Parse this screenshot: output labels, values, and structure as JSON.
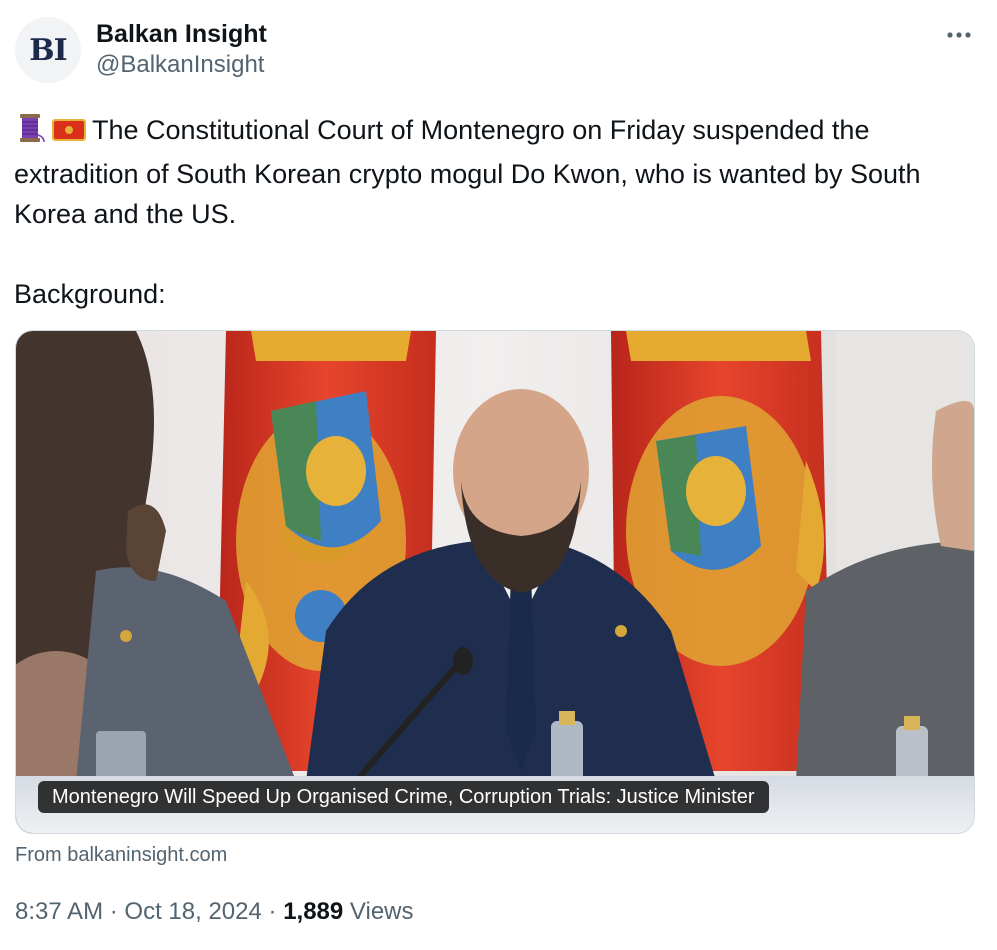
{
  "author": {
    "avatar_text": "BI",
    "display_name": "Balkan Insight",
    "handle": "@BalkanInsight"
  },
  "more_icon": "more-horizontal-icon",
  "tweet": {
    "emoji_1": "thread-spool-emoji",
    "emoji_2": "montenegro-flag-emoji",
    "text_line_1": "The Constitutional Court of Montenegro on Friday suspended the extradition of South Korean crypto mogul Do Kwon, who is wanted by South Korea and the US.",
    "text_line_2": "Background:"
  },
  "card": {
    "title": "Montenegro Will Speed Up Organised Crime, Corruption Trials: Justice Minister",
    "source": "From balkaninsight.com"
  },
  "meta": {
    "time": "8:37 AM",
    "separator": "·",
    "date": "Oct 18, 2024",
    "views_count": "1,889",
    "views_label": "Views"
  },
  "colors": {
    "text_primary": "#0f1419",
    "text_secondary": "#536471",
    "border": "#cfd9de",
    "flag_red": "#d9301c",
    "flag_gold": "#e8b13a"
  }
}
